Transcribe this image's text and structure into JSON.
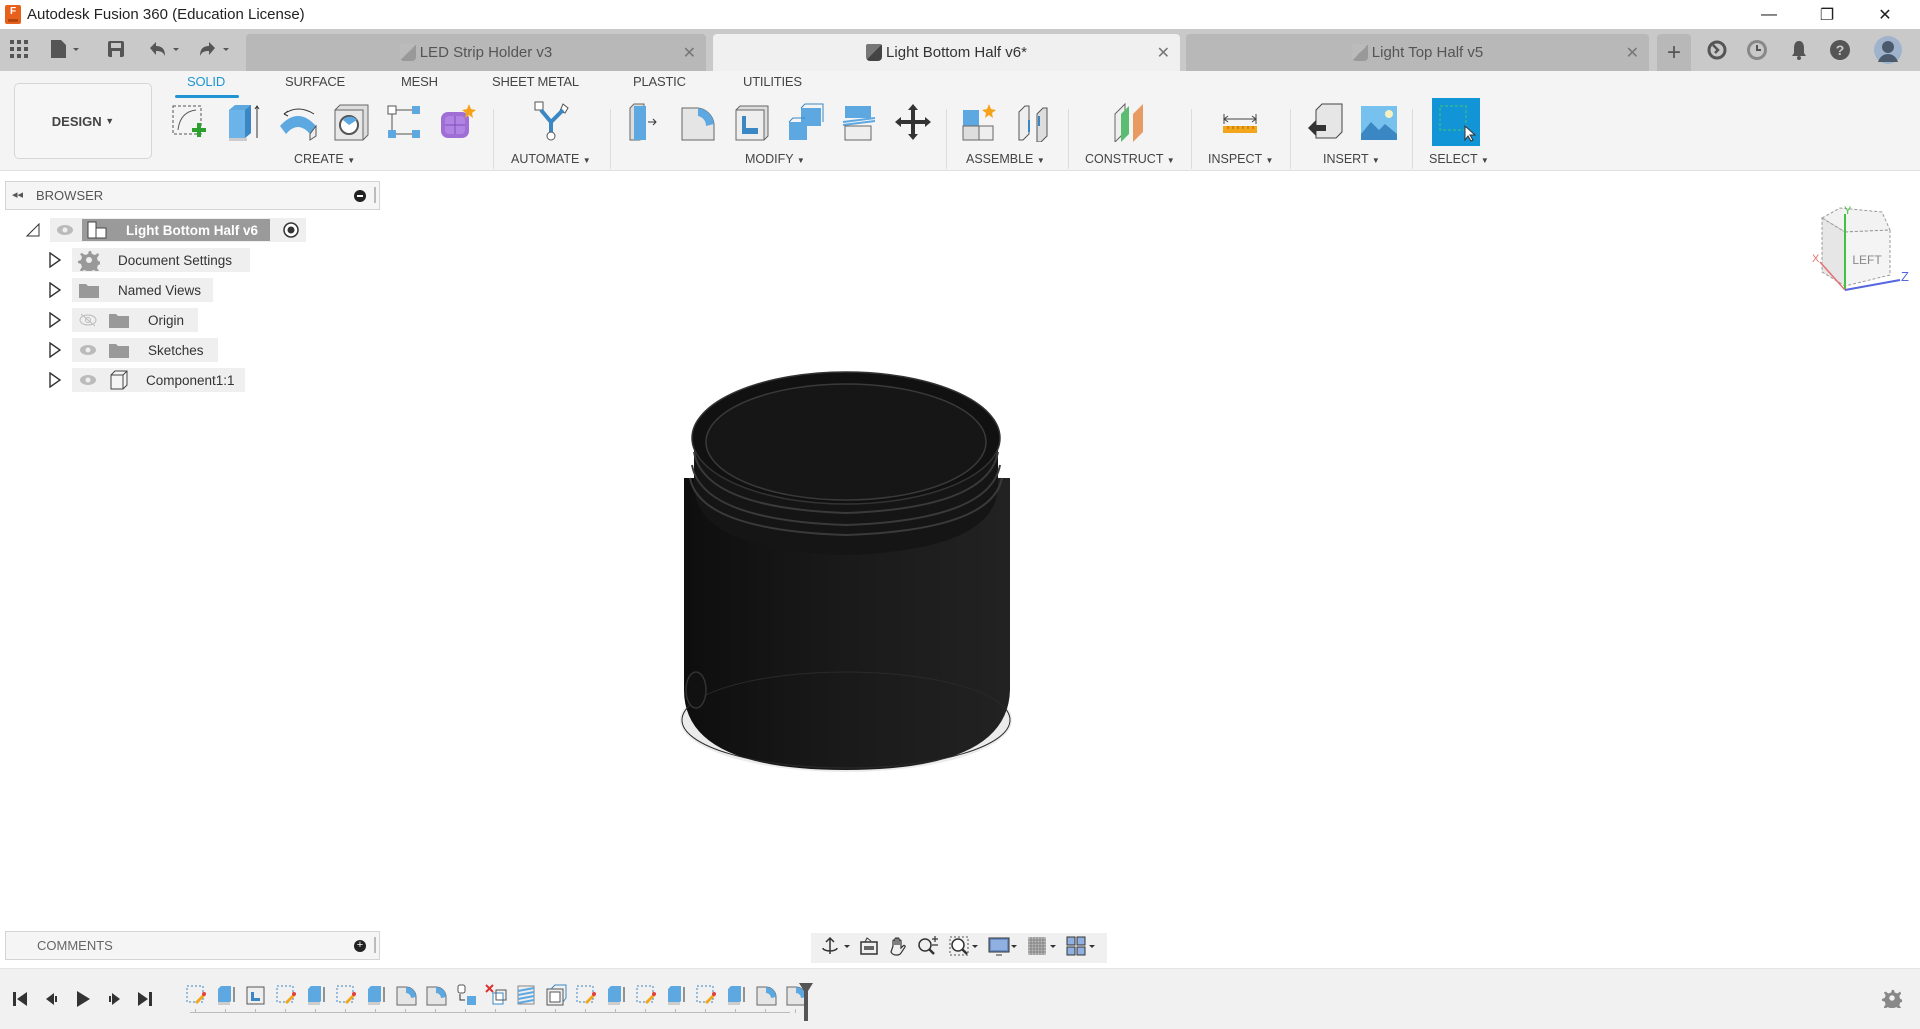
{
  "window": {
    "title": "Autodesk Fusion 360 (Education License)",
    "logo_letter": "F",
    "controls": {
      "minimize": "—",
      "restore": "❐",
      "close": "✕"
    }
  },
  "quick_access": {
    "icons": [
      "app-grid-icon",
      "file-icon",
      "save-icon",
      "undo-icon",
      "redo-icon"
    ]
  },
  "doc_tabs": [
    {
      "label": "LED Strip Holder v3",
      "active": false
    },
    {
      "label": "Light Bottom Half v6*",
      "active": true
    },
    {
      "label": "Light Top Half v5",
      "active": false
    }
  ],
  "tabbar_right": {
    "new_tab": "+",
    "icons": [
      "extensions-icon",
      "job-status-icon",
      "notifications-icon",
      "help-icon",
      "user-avatar"
    ]
  },
  "workspace": {
    "label": "DESIGN"
  },
  "ribbon_tabs": [
    {
      "label": "SOLID",
      "active": true
    },
    {
      "label": "SURFACE",
      "active": false
    },
    {
      "label": "MESH",
      "active": false
    },
    {
      "label": "SHEET METAL",
      "active": false
    },
    {
      "label": "PLASTIC",
      "active": false
    },
    {
      "label": "UTILITIES",
      "active": false
    }
  ],
  "ribbon_groups": [
    {
      "label": "CREATE",
      "tools": [
        "create-sketch",
        "extrude",
        "revolve",
        "hole",
        "pattern",
        "create-form"
      ]
    },
    {
      "label": "AUTOMATE",
      "tools": [
        "automate"
      ]
    },
    {
      "label": "MODIFY",
      "tools": [
        "press-pull",
        "fillet",
        "shell",
        "combine",
        "split-body",
        "move-copy"
      ]
    },
    {
      "label": "ASSEMBLE",
      "tools": [
        "new-component",
        "joint"
      ]
    },
    {
      "label": "CONSTRUCT",
      "tools": [
        "offset-plane"
      ]
    },
    {
      "label": "INSPECT",
      "tools": [
        "measure"
      ]
    },
    {
      "label": "INSERT",
      "tools": [
        "insert-derive",
        "insert-canvas"
      ]
    },
    {
      "label": "SELECT",
      "tools": [
        "select"
      ]
    }
  ],
  "browser": {
    "title": "BROWSER",
    "root": "Light Bottom Half v6",
    "items": [
      {
        "label": "Document Settings",
        "icon": "gear",
        "visible": null
      },
      {
        "label": "Named Views",
        "icon": "folder",
        "visible": null
      },
      {
        "label": "Origin",
        "icon": "folder",
        "visible": false
      },
      {
        "label": "Sketches",
        "icon": "folder",
        "visible": true
      },
      {
        "label": "Component1:1",
        "icon": "component",
        "visible": true
      }
    ]
  },
  "viewcube": {
    "face": "LEFT",
    "axes": {
      "x": "X",
      "y": "Y",
      "z": "Z"
    }
  },
  "comments": {
    "title": "COMMENTS"
  },
  "navbar": {
    "icons": [
      "orbit-icon",
      "look-at-icon",
      "pan-icon",
      "zoom-icon",
      "fit-icon",
      "display-settings-icon",
      "grid-icon",
      "viewports-icon"
    ]
  },
  "timeline": {
    "controls": [
      "first",
      "previous",
      "play",
      "next",
      "last"
    ],
    "features": [
      "sketch",
      "extrude",
      "shell",
      "sketch",
      "extrude",
      "sketch",
      "extrude",
      "fillet",
      "fillet",
      "move",
      "delete",
      "coil",
      "offset",
      "sketch",
      "extrude",
      "sketch",
      "extrude",
      "sketch",
      "extrude",
      "fillet",
      "fillet"
    ]
  },
  "colors": {
    "accent": "#1f96d3",
    "model": "#141414"
  }
}
